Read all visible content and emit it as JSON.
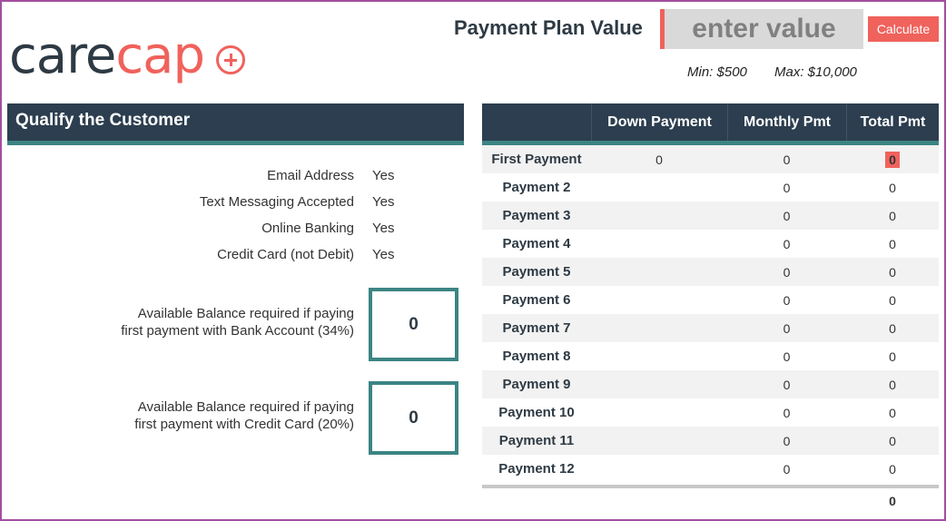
{
  "logo": {
    "care": "care",
    "cap": "cap"
  },
  "header": {
    "payment_plan_label": "Payment Plan Value",
    "value_placeholder": "enter value",
    "calculate_label": "Calculate",
    "min_text": "Min: $500",
    "max_text": "Max: $10,000"
  },
  "qualify": {
    "title": "Qualify the Customer",
    "items": [
      {
        "label": "Email Address",
        "value": "Yes"
      },
      {
        "label": "Text Messaging Accepted",
        "value": "Yes"
      },
      {
        "label": "Online Banking",
        "value": "Yes"
      },
      {
        "label": "Credit Card (not Debit)",
        "value": "Yes"
      }
    ],
    "bank_label_1": "Available Balance required if paying",
    "bank_label_2": "first payment with Bank Account (34%)",
    "bank_value": "0",
    "card_label_1": "Available Balance required if paying",
    "card_label_2": "first payment with Credit Card (20%)",
    "card_value": "0"
  },
  "table": {
    "headers": [
      "",
      "Down Payment",
      "Monthly Pmt",
      "Total Pmt"
    ],
    "rows": [
      {
        "name": "First Payment",
        "down": "0",
        "monthly": "0",
        "total": "0"
      },
      {
        "name": "Payment 2",
        "down": "",
        "monthly": "0",
        "total": "0"
      },
      {
        "name": "Payment 3",
        "down": "",
        "monthly": "0",
        "total": "0"
      },
      {
        "name": "Payment 4",
        "down": "",
        "monthly": "0",
        "total": "0"
      },
      {
        "name": "Payment 5",
        "down": "",
        "monthly": "0",
        "total": "0"
      },
      {
        "name": "Payment 6",
        "down": "",
        "monthly": "0",
        "total": "0"
      },
      {
        "name": "Payment 7",
        "down": "",
        "monthly": "0",
        "total": "0"
      },
      {
        "name": "Payment 8",
        "down": "",
        "monthly": "0",
        "total": "0"
      },
      {
        "name": "Payment 9",
        "down": "",
        "monthly": "0",
        "total": "0"
      },
      {
        "name": "Payment 10",
        "down": "",
        "monthly": "0",
        "total": "0"
      },
      {
        "name": "Payment 11",
        "down": "",
        "monthly": "0",
        "total": "0"
      },
      {
        "name": "Payment 12",
        "down": "",
        "monthly": "0",
        "total": "0"
      }
    ],
    "grand_total": "0"
  },
  "colors": {
    "accent": "#f0625c",
    "header_bg": "#2c3e4f",
    "teal": "#3b8583",
    "frame": "#a24ea0"
  }
}
